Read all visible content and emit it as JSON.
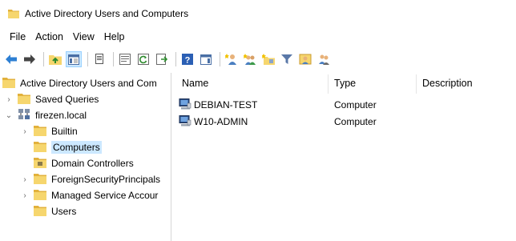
{
  "window": {
    "title": "Active Directory Users and Computers",
    "icon": "folder-app-icon"
  },
  "menubar": {
    "items": [
      "File",
      "Action",
      "View",
      "Help"
    ]
  },
  "toolbar": {
    "buttons": [
      "back-arrow-icon",
      "forward-arrow-icon",
      "up-folder-icon",
      "show-hide-console-tree-icon",
      "copy-icon",
      "properties-icon",
      "refresh-icon",
      "export-list-icon",
      "help-icon",
      "action-pane-icon",
      "new-user-icon",
      "new-group-icon",
      "new-ou-icon",
      "filter-icon",
      "add-to-group-icon",
      "delegate-control-icon"
    ]
  },
  "tree": {
    "root": "Active Directory Users and Com",
    "items": [
      {
        "label": "Saved Queries",
        "expanded": false
      },
      {
        "label": "firezen.local",
        "expanded": true
      },
      {
        "label": "Builtin",
        "expanded": false
      },
      {
        "label": "Computers",
        "selected": true
      },
      {
        "label": "Domain Controllers"
      },
      {
        "label": "ForeignSecurityPrincipals",
        "expanded": false
      },
      {
        "label": "Managed Service Accour",
        "expanded": false
      },
      {
        "label": "Users"
      }
    ]
  },
  "list": {
    "columns": [
      "Name",
      "Type",
      "Description"
    ],
    "rows": [
      {
        "name": "DEBIAN-TEST",
        "type": "Computer",
        "description": ""
      },
      {
        "name": "W10-ADMIN",
        "type": "Computer",
        "description": ""
      }
    ]
  },
  "colors": {
    "selection": "#cce8ff",
    "folder": "#f6d66e",
    "folder_dark": "#e2b13c"
  }
}
